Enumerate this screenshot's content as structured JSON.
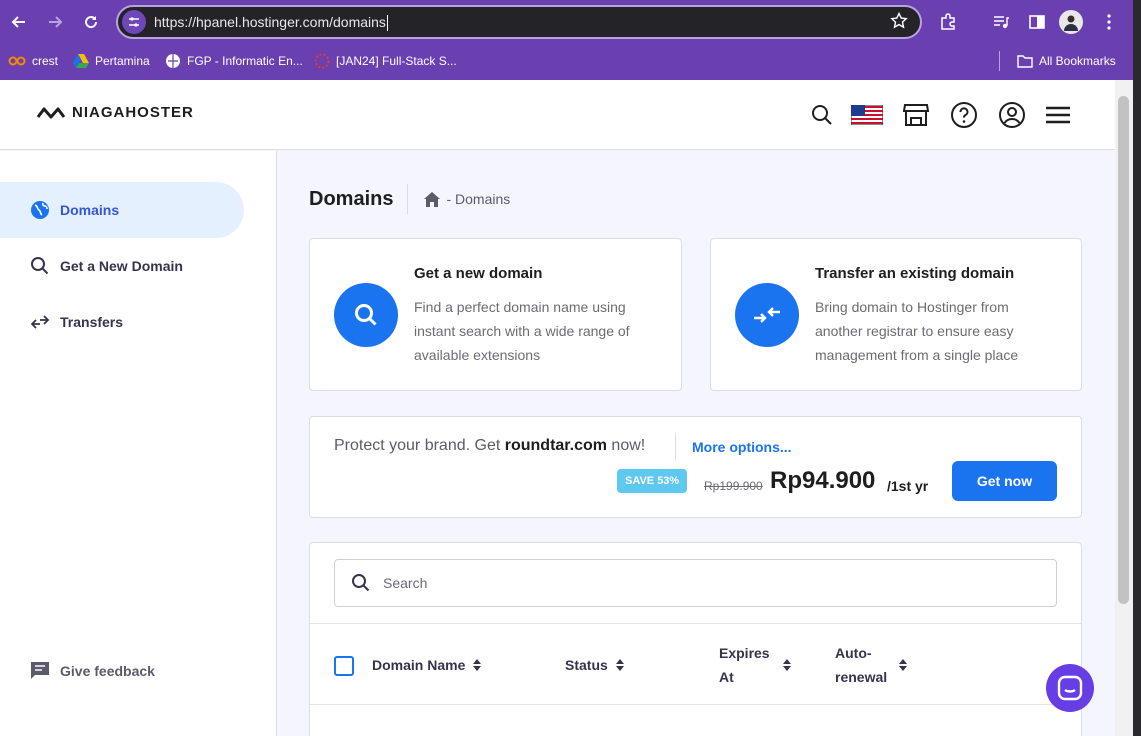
{
  "browser": {
    "url": "https://hpanel.hostinger.com/domains",
    "bookmarks": [
      {
        "label": "crest",
        "icon": "infinity-icon"
      },
      {
        "label": "Pertamina",
        "icon": "google-drive-icon"
      },
      {
        "label": "FGP - Informatic En...",
        "icon": "globe-icon"
      },
      {
        "label": "[JAN24] Full-Stack S...",
        "icon": "dotted-circle-icon"
      }
    ],
    "all_bookmarks": "All Bookmarks"
  },
  "header": {
    "logo": "NIAGAHOSTER",
    "icons": [
      "search-icon",
      "us-flag-icon",
      "store-icon",
      "help-icon",
      "account-icon",
      "menu-icon"
    ]
  },
  "sidebar": {
    "items": [
      {
        "label": "Domains",
        "icon": "globe-icon",
        "active": true
      },
      {
        "label": "Get a New Domain",
        "icon": "search-icon"
      },
      {
        "label": "Transfers",
        "icon": "transfer-icon"
      }
    ],
    "feedback": "Give feedback"
  },
  "main": {
    "title": "Domains",
    "breadcrumb": "- Domains",
    "cards": [
      {
        "title": "Get a new domain",
        "desc": "Find a perfect domain name using instant search with a wide range of available extensions",
        "icon": "search-icon"
      },
      {
        "title": "Transfer an existing domain",
        "desc": "Bring domain to Hostinger from another registrar to ensure easy management from a single place",
        "icon": "transfer-arrows-icon"
      }
    ],
    "promo": {
      "prefix": "Protect your brand. Get ",
      "domain": "roundtar.com",
      "suffix": " now!",
      "more": "More options...",
      "badge": "SAVE 53%",
      "old_price": "Rp199.900",
      "price": "Rp94.900",
      "period": "/1st yr",
      "cta": "Get now"
    },
    "table": {
      "search_placeholder": "Search",
      "columns": [
        "Domain Name",
        "Status",
        "Expires At",
        "Auto-renewal"
      ]
    }
  },
  "colors": {
    "brand_purple": "#673de6",
    "primary_blue": "#1a74f0",
    "chrome_purple": "#6a3fb0"
  }
}
